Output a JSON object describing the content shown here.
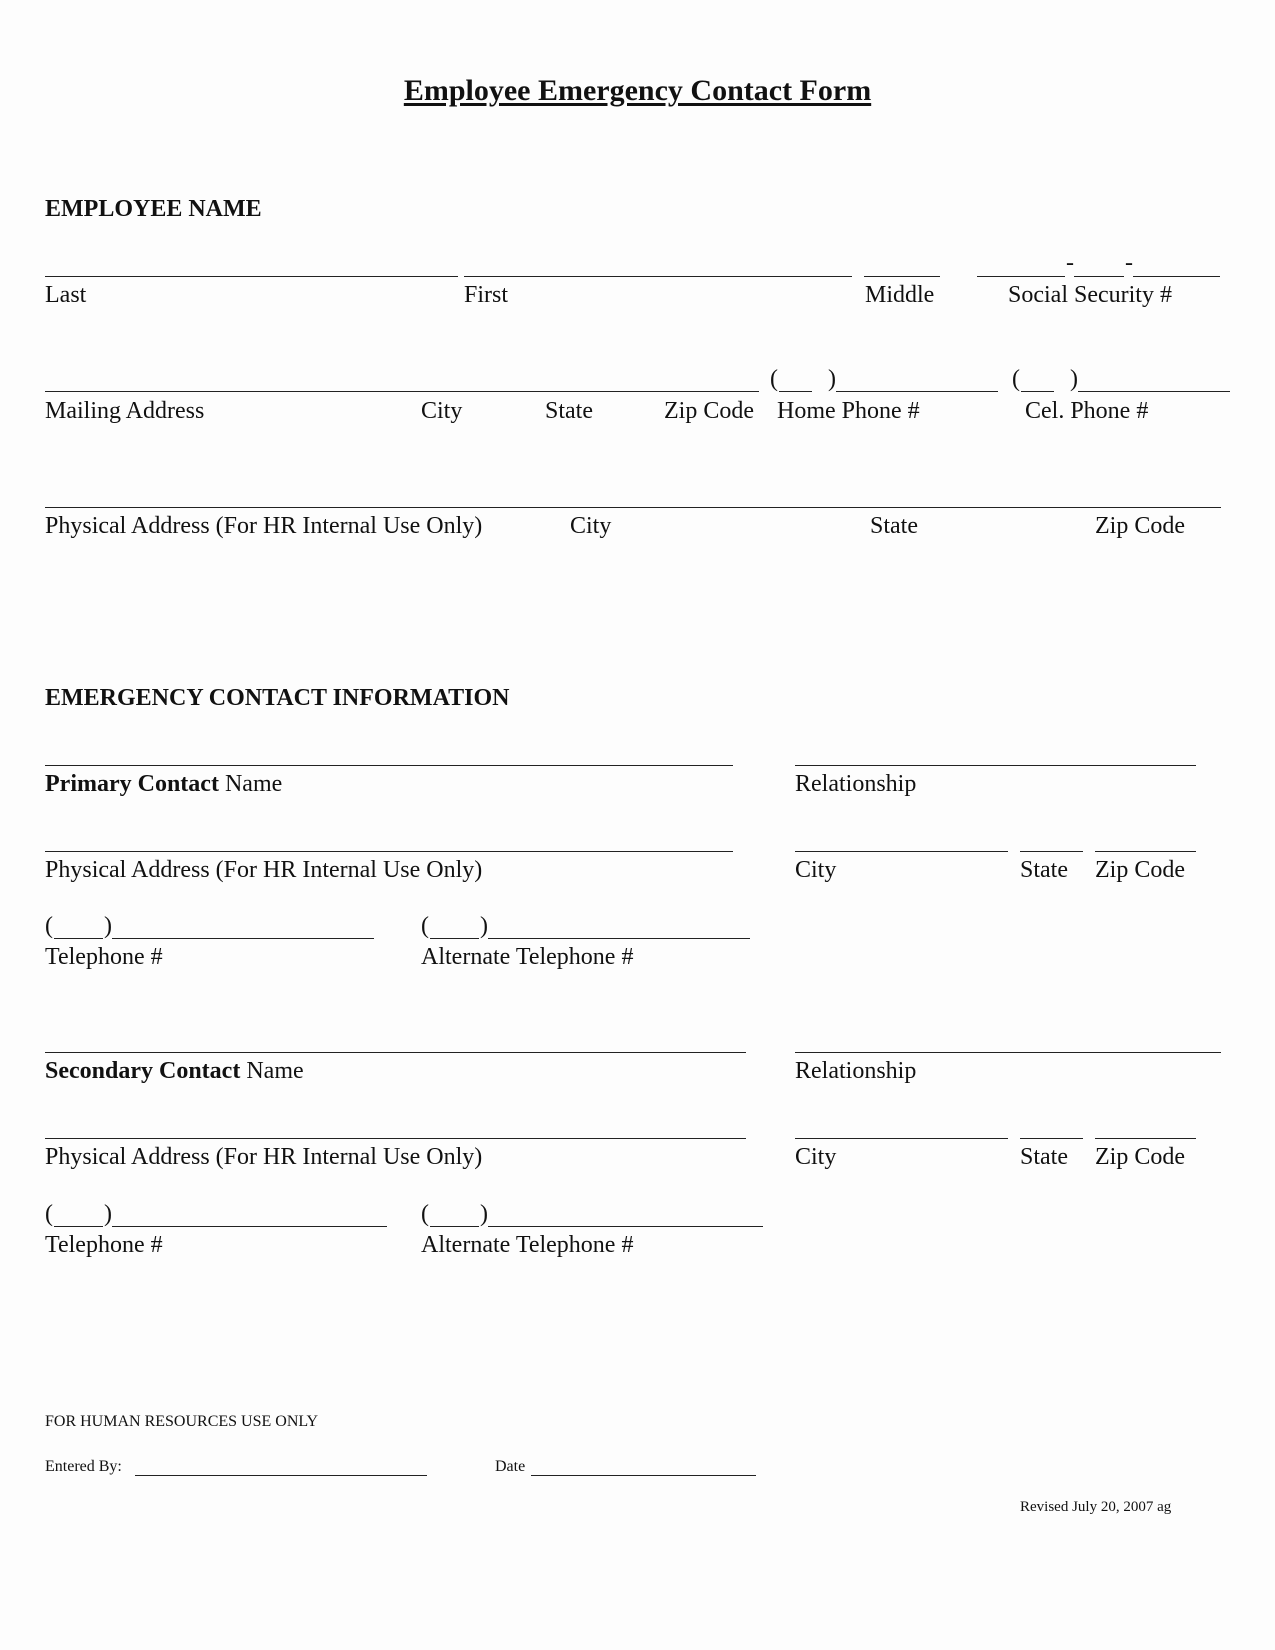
{
  "title": "Employee Emergency Contact Form",
  "employee": {
    "section_title": "EMPLOYEE NAME",
    "labels": {
      "last": "Last",
      "first": "First",
      "middle": "Middle",
      "ssn": "Social Security #",
      "mailing_address": "Mailing Address",
      "city": "City",
      "state": "State",
      "zip": "Zip Code",
      "home_phone": "Home Phone #",
      "cell_phone": "Cel. Phone #",
      "physical_address": "Physical Address (For HR Internal Use Only)",
      "phys_city": "City",
      "phys_state": "State",
      "phys_zip": "Zip Code"
    },
    "ssn_separator": "-",
    "area_code_paren_open": "(",
    "area_code_paren_close": ")"
  },
  "emergency": {
    "section_title": "EMERGENCY CONTACT INFORMATION",
    "primary": {
      "name_bold": "Primary Contact",
      "name_suffix": " Name",
      "relationship": "Relationship",
      "physical_address": "Physical Address (For HR Internal Use Only)",
      "city": "City",
      "state": "State",
      "zip": "Zip Code",
      "telephone": "Telephone #",
      "alt_telephone": "Alternate Telephone #"
    },
    "secondary": {
      "name_bold": "Secondary Contact",
      "name_suffix": " Name",
      "relationship": "Relationship",
      "physical_address": "Physical Address (For HR Internal Use Only)",
      "city": "City",
      "state": "State",
      "zip": "Zip Code",
      "telephone": "Telephone #",
      "alt_telephone": "Alternate Telephone #"
    }
  },
  "hr": {
    "title": "FOR HUMAN RESOURCES USE ONLY",
    "entered_by": "Entered By:",
    "date": "Date",
    "revised": "Revised July 20, 2007 ag"
  }
}
